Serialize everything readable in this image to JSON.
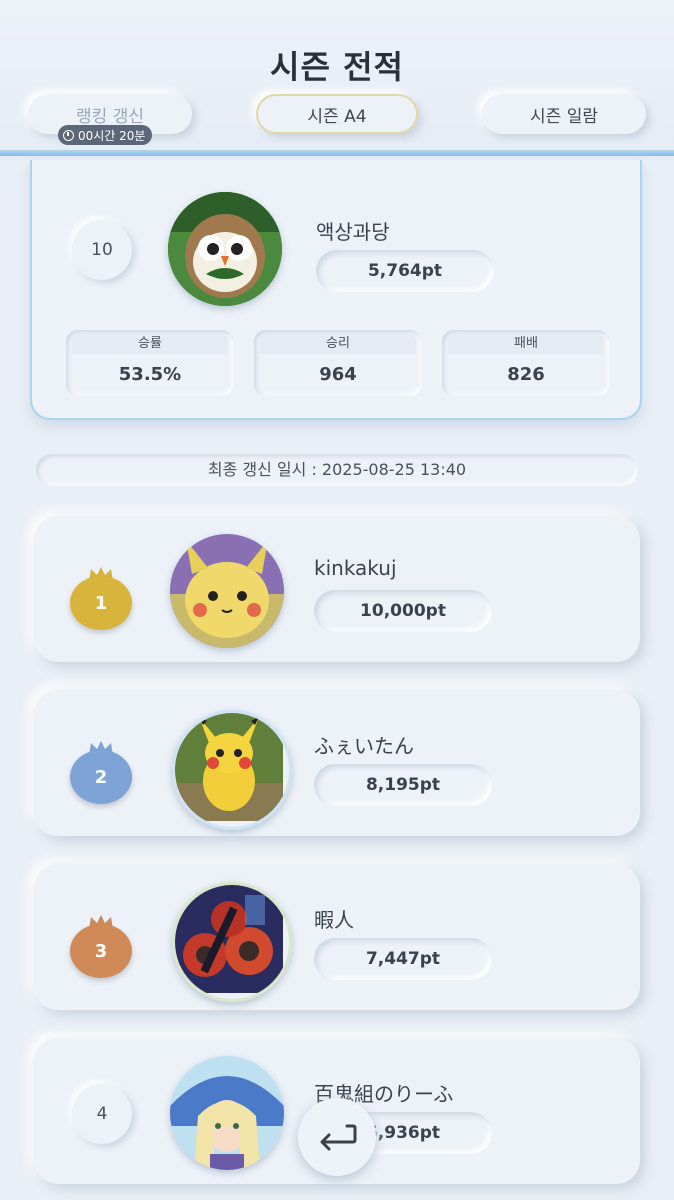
{
  "header": {
    "title": "시즌 전적",
    "buttons": {
      "refresh_label": "랭킹 갱신",
      "season_label": "시즌 A4",
      "season_list_label": "시즌 일람"
    },
    "timer": "00시간 20분"
  },
  "my_record": {
    "rank": "10",
    "name": "액상과당",
    "points": "5,764pt",
    "stats": [
      {
        "label": "승률",
        "value": "53.5%"
      },
      {
        "label": "승리",
        "value": "964"
      },
      {
        "label": "패배",
        "value": "826"
      }
    ]
  },
  "last_updated": "최종 갱신 일시 : 2025-08-25 13:40",
  "ranking": [
    {
      "rank": "1",
      "name": "kinkakuj",
      "points": "10,000pt",
      "medal_color": "#d9b43c"
    },
    {
      "rank": "2",
      "name": "ふぇいたん",
      "points": "8,195pt",
      "medal_color": "#7ea3d6"
    },
    {
      "rank": "3",
      "name": "暇人",
      "points": "7,447pt",
      "medal_color": "#cf8a58"
    },
    {
      "rank": "4",
      "name": "百鬼組のりーふ",
      "points": "5,936pt"
    }
  ],
  "colors": {
    "accent": "#7ebfe3",
    "card_border": "#a8d4f0",
    "gold_border": "#e3d7a8"
  }
}
